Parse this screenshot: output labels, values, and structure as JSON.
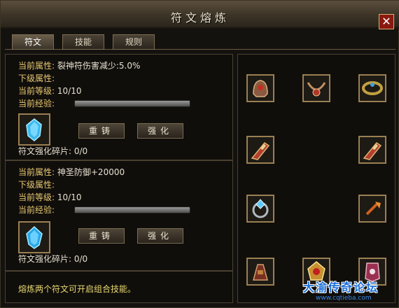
{
  "window": {
    "title": "符文熔炼",
    "close_label": "✕"
  },
  "tabs": [
    {
      "label": "符文",
      "active": true
    },
    {
      "label": "技能",
      "active": false
    },
    {
      "label": "规则",
      "active": false
    }
  ],
  "rune1": {
    "current_attr_label": "当前属性:",
    "current_attr_value": "裂神符伤害减少:5.0%",
    "next_attr_label": "下级属性:",
    "level_label": "当前等级:",
    "level_value": "10/10",
    "exp_label": "当前经验:",
    "exp_progress": 0,
    "recast_label": "重铸",
    "enhance_label": "强化",
    "fragments_label": "符文强化碎片:",
    "fragments_value": "0/0"
  },
  "rune2": {
    "current_attr_label": "当前属性:",
    "current_attr_value": "神圣防御+20000",
    "next_attr_label": "下级属性:",
    "level_label": "当前等级:",
    "level_value": "10/10",
    "exp_label": "当前经验:",
    "exp_progress": 0,
    "recast_label": "重铸",
    "enhance_label": "强化",
    "fragments_label": "符文强化碎片:",
    "fragments_value": "0/0"
  },
  "footer_note": "熔炼两个符文可开启组合技能。",
  "equipment_slots": [
    {
      "icon": "helmet-icon"
    },
    {
      "icon": "necklace-icon"
    },
    {
      "icon": "bracelet-icon"
    },
    {
      "icon": "gauntlet-icon"
    },
    {
      "icon": "gauntlet-icon"
    },
    {
      "icon": "ring-icon"
    },
    {
      "icon": "medal-icon"
    },
    {
      "icon": "belt-icon"
    },
    {
      "icon": "amulet-icon"
    },
    {
      "icon": "boots-icon"
    }
  ],
  "watermark": {
    "title": "大渝传奇论坛",
    "url": "www.cqtieba.com"
  },
  "colors": {
    "label": "#e8c870",
    "accent_border": "#9a8052",
    "close_red": "#8a1a10",
    "rune_blue": "#3ab8f0"
  }
}
